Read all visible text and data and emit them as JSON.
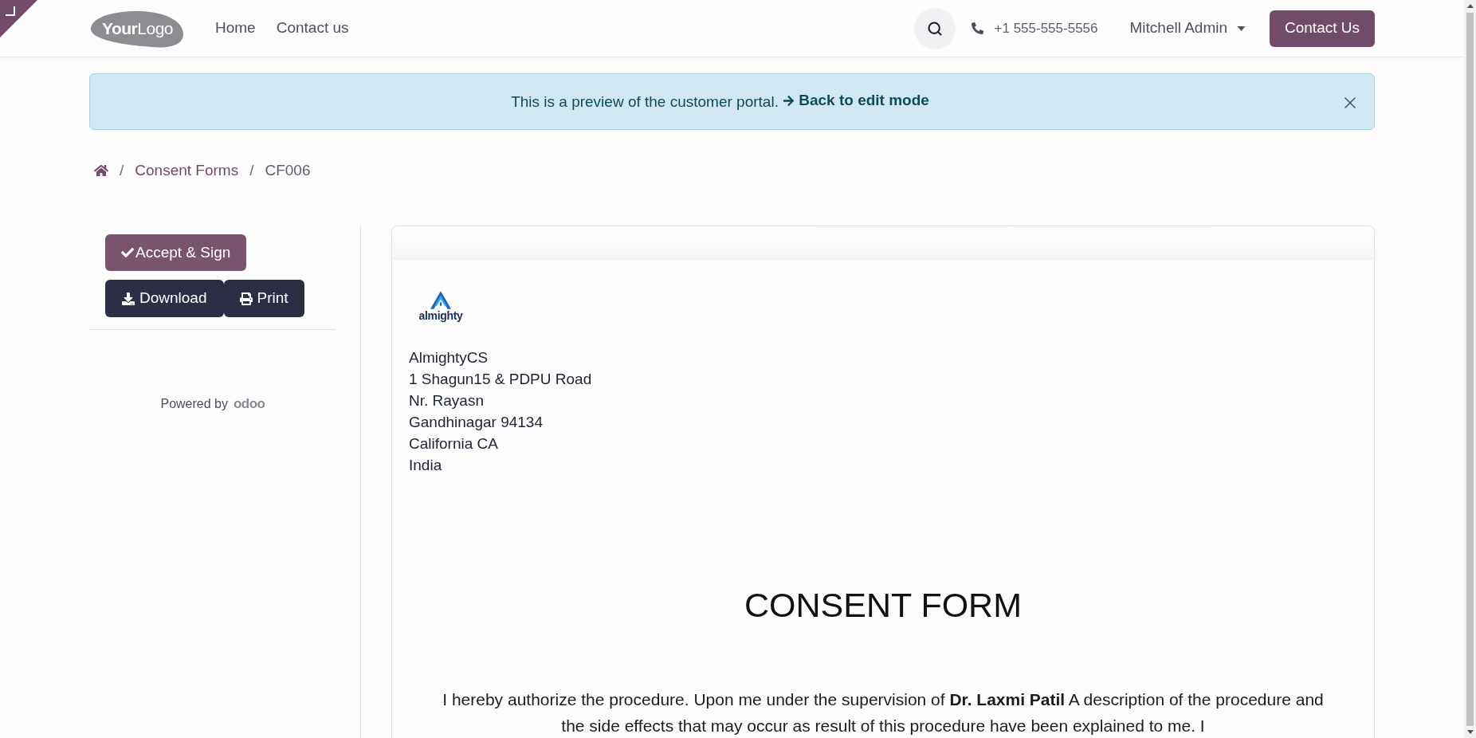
{
  "header": {
    "logo": {
      "bold": "Your",
      "light": "Logo"
    },
    "nav": [
      {
        "label": "Home"
      },
      {
        "label": "Contact us"
      }
    ],
    "phone": "+1 555-555-5556",
    "user": "Mitchell Admin",
    "cta": "Contact Us"
  },
  "notice": {
    "text": "This is a preview of the customer portal.",
    "link": "Back to edit mode"
  },
  "breadcrumb": [
    {
      "kind": "home"
    },
    {
      "kind": "separator",
      "text": "/"
    },
    {
      "kind": "link",
      "text": "Consent Forms"
    },
    {
      "kind": "separator",
      "text": "/"
    },
    {
      "kind": "current",
      "text": "CF006"
    }
  ],
  "sidebar": {
    "accept_button": "Accept & Sign",
    "download_button": "Download",
    "print_button": "Print",
    "powered_by": "Powered by",
    "brand": "odoo"
  },
  "document": {
    "company_logo": "almighty",
    "address": [
      "AlmightyCS",
      "1 Shagun15 & PDPU Road",
      "Nr. Rayasn",
      "Gandhinagar 94134",
      "California CA",
      "India"
    ],
    "title": "CONSENT FORM",
    "body": "I hereby authorize the procedure. Upon me under the supervision of **Dr. Laxmi Patil** A description of the procedure and the side effects that may occur as result of this procedure have been explained to me. I"
  }
}
